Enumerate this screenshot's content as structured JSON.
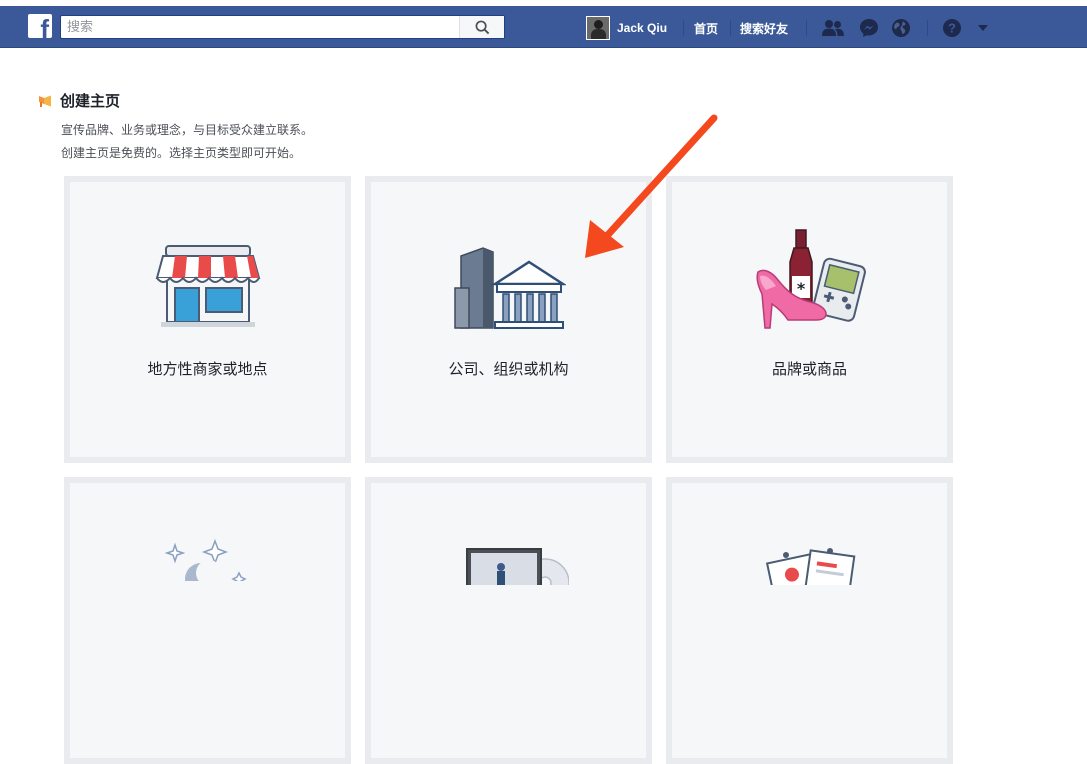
{
  "topbar": {
    "search_placeholder": "搜索",
    "profile_name": "Jack Qiu",
    "nav_home": "首页",
    "nav_find_friends": "搜索好友",
    "colors": {
      "bar": "#3b5998"
    }
  },
  "page": {
    "title": "创建主页",
    "desc_line1": "宣传品牌、业务或理念，与目标受众建立联系。",
    "desc_line2": "创建主页是免费的。选择主页类型即可开始。"
  },
  "categories": [
    {
      "label": "地方性商家或地点",
      "icon": "storefront-icon"
    },
    {
      "label": "公司、组织或机构",
      "icon": "company-buildings-icon"
    },
    {
      "label": "品牌或商品",
      "icon": "brand-products-icon"
    },
    {
      "label": "",
      "icon": "stars-moon-icon"
    },
    {
      "label": "",
      "icon": "media-icon"
    },
    {
      "label": "",
      "icon": "cards-icon"
    }
  ],
  "annotation": {
    "arrow_color": "#f4491e"
  }
}
